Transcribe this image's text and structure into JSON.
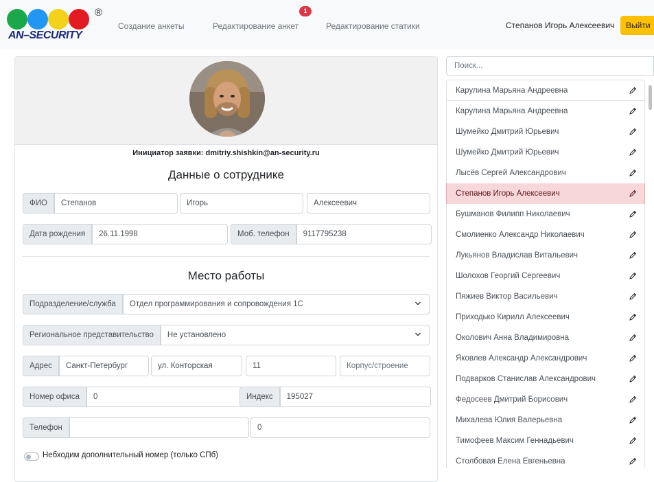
{
  "header": {
    "logo": {
      "wordmark": "AN–SECURITY",
      "reg_mark": "®",
      "dot_colors": [
        "#1aa84a",
        "#2196f3",
        "#f2d21a",
        "#e31b23"
      ]
    },
    "nav": [
      {
        "label": "Создание анкеты"
      },
      {
        "label": "Редактирование анкет",
        "badge": "1"
      },
      {
        "label": "Редактирование статики"
      }
    ],
    "user_name": "Степанов Игорь Алексеевич",
    "logout_label": "Выйти"
  },
  "form": {
    "initiator": "Инициатор заявки: dmitriy.shishkin@an-security.ru",
    "employee_title": "Данные о сотруднике",
    "fio_label": "ФИО",
    "last_name": "Степанов",
    "first_name": "Игорь",
    "middle_name": "Алексеевич",
    "birth_label": "Дата рождения",
    "birth_date": "26.11.1998",
    "mobile_label": "Моб. телефон",
    "mobile": "9117795238",
    "work_title": "Место работы",
    "department_label": "Подразделение/служба",
    "department": "Отдел программирования и сопровождения 1С",
    "regional_label": "Региональное представительство",
    "regional": "Не установлено",
    "address_label": "Адрес",
    "city": "Санкт-Петербург",
    "street": "ул. Конторская",
    "house": "11",
    "building_placeholder": "Корпус/строение",
    "office_label": "Номер офиса",
    "office": "0",
    "index_label": "Индекс",
    "index": "195027",
    "phone_label": "Телефон",
    "phone": "",
    "phone_ext": "0",
    "extra_number_label": "Небходим дополнительный номер (только СПб)"
  },
  "sidebar": {
    "search_placeholder": "Поиск...",
    "employees": [
      {
        "name": "Карулина Марьяна Андреевна"
      },
      {
        "name": "Карулина Марьяна Андреевна"
      },
      {
        "name": "Шумейко Дмитрий Юрьевич"
      },
      {
        "name": "Шумейко Дмитрий Юрьевич"
      },
      {
        "name": "Лысёв Сергей Александрович"
      },
      {
        "name": "Степанов Игорь Алексеевич",
        "active": true
      },
      {
        "name": "Бушманов Филипп Николаевич"
      },
      {
        "name": "Смолиенко Александр Николаевич"
      },
      {
        "name": "Лукьянов Владислав Витальевич"
      },
      {
        "name": "Шолохов Георгий Сергеевич"
      },
      {
        "name": "Пяжиев Виктор Васильевич"
      },
      {
        "name": "Приходько Кирилл Алексеевич"
      },
      {
        "name": "Околович Анна Владимировна"
      },
      {
        "name": "Яковлев Александр Александрович"
      },
      {
        "name": "Подварков Станислав Александрович"
      },
      {
        "name": "Федосеев Дмитрий Борисович"
      },
      {
        "name": "Михалева Юлия Валерьевна"
      },
      {
        "name": "Тимофеев Максим Геннадьевич"
      },
      {
        "name": "Столбовая Елена Евгеньевна"
      }
    ]
  },
  "colors": {
    "accent": "#ffc107",
    "active_row": "#f8d7da",
    "badge": "#dc3545"
  }
}
